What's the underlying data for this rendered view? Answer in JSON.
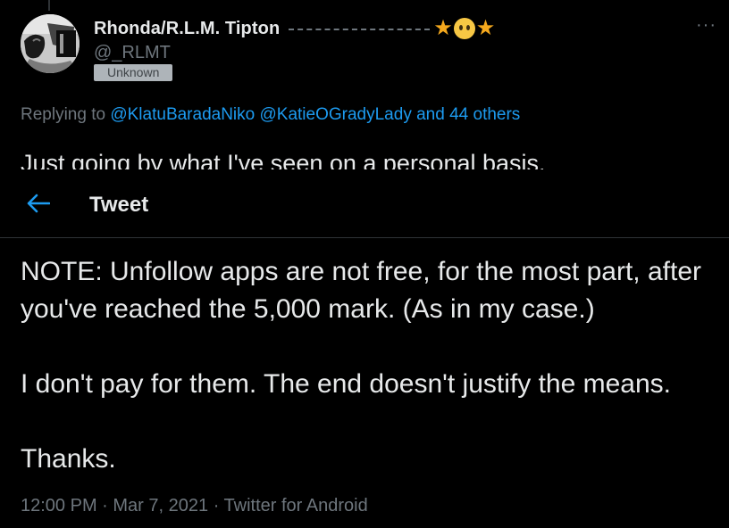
{
  "author": {
    "display_name": "Rhonda/R.L.M. Tipton",
    "handle": "@_RLMT",
    "badge": "Unknown",
    "name_decoration": [
      "star-icon",
      "flushed-face-icon",
      "star-icon"
    ]
  },
  "more_label": "···",
  "replying": {
    "prefix": "Replying to",
    "user1": "@KlatuBaradaNiko",
    "user2": "@KatieOGradyLady",
    "others": "and 44 others"
  },
  "previous_tweet_text": "Just going by what I've seen on a personal basis.",
  "header": {
    "back_icon": "back-arrow-icon",
    "title": "Tweet"
  },
  "tweet": {
    "paragraphs": [
      "NOTE: Unfollow apps are not free, for the most part, after you've reached the 5,000 mark. (As in my case.)",
      "I don't pay for them. The end doesn't justify the means.",
      "Thanks."
    ]
  },
  "meta": {
    "time": "12:00 PM",
    "date": "Mar 7, 2021",
    "source": "Twitter for Android"
  },
  "colors": {
    "background": "#000000",
    "link": "#1d9bf0",
    "secondary_text": "#6e767d",
    "primary_text": "#e7e9ea"
  }
}
